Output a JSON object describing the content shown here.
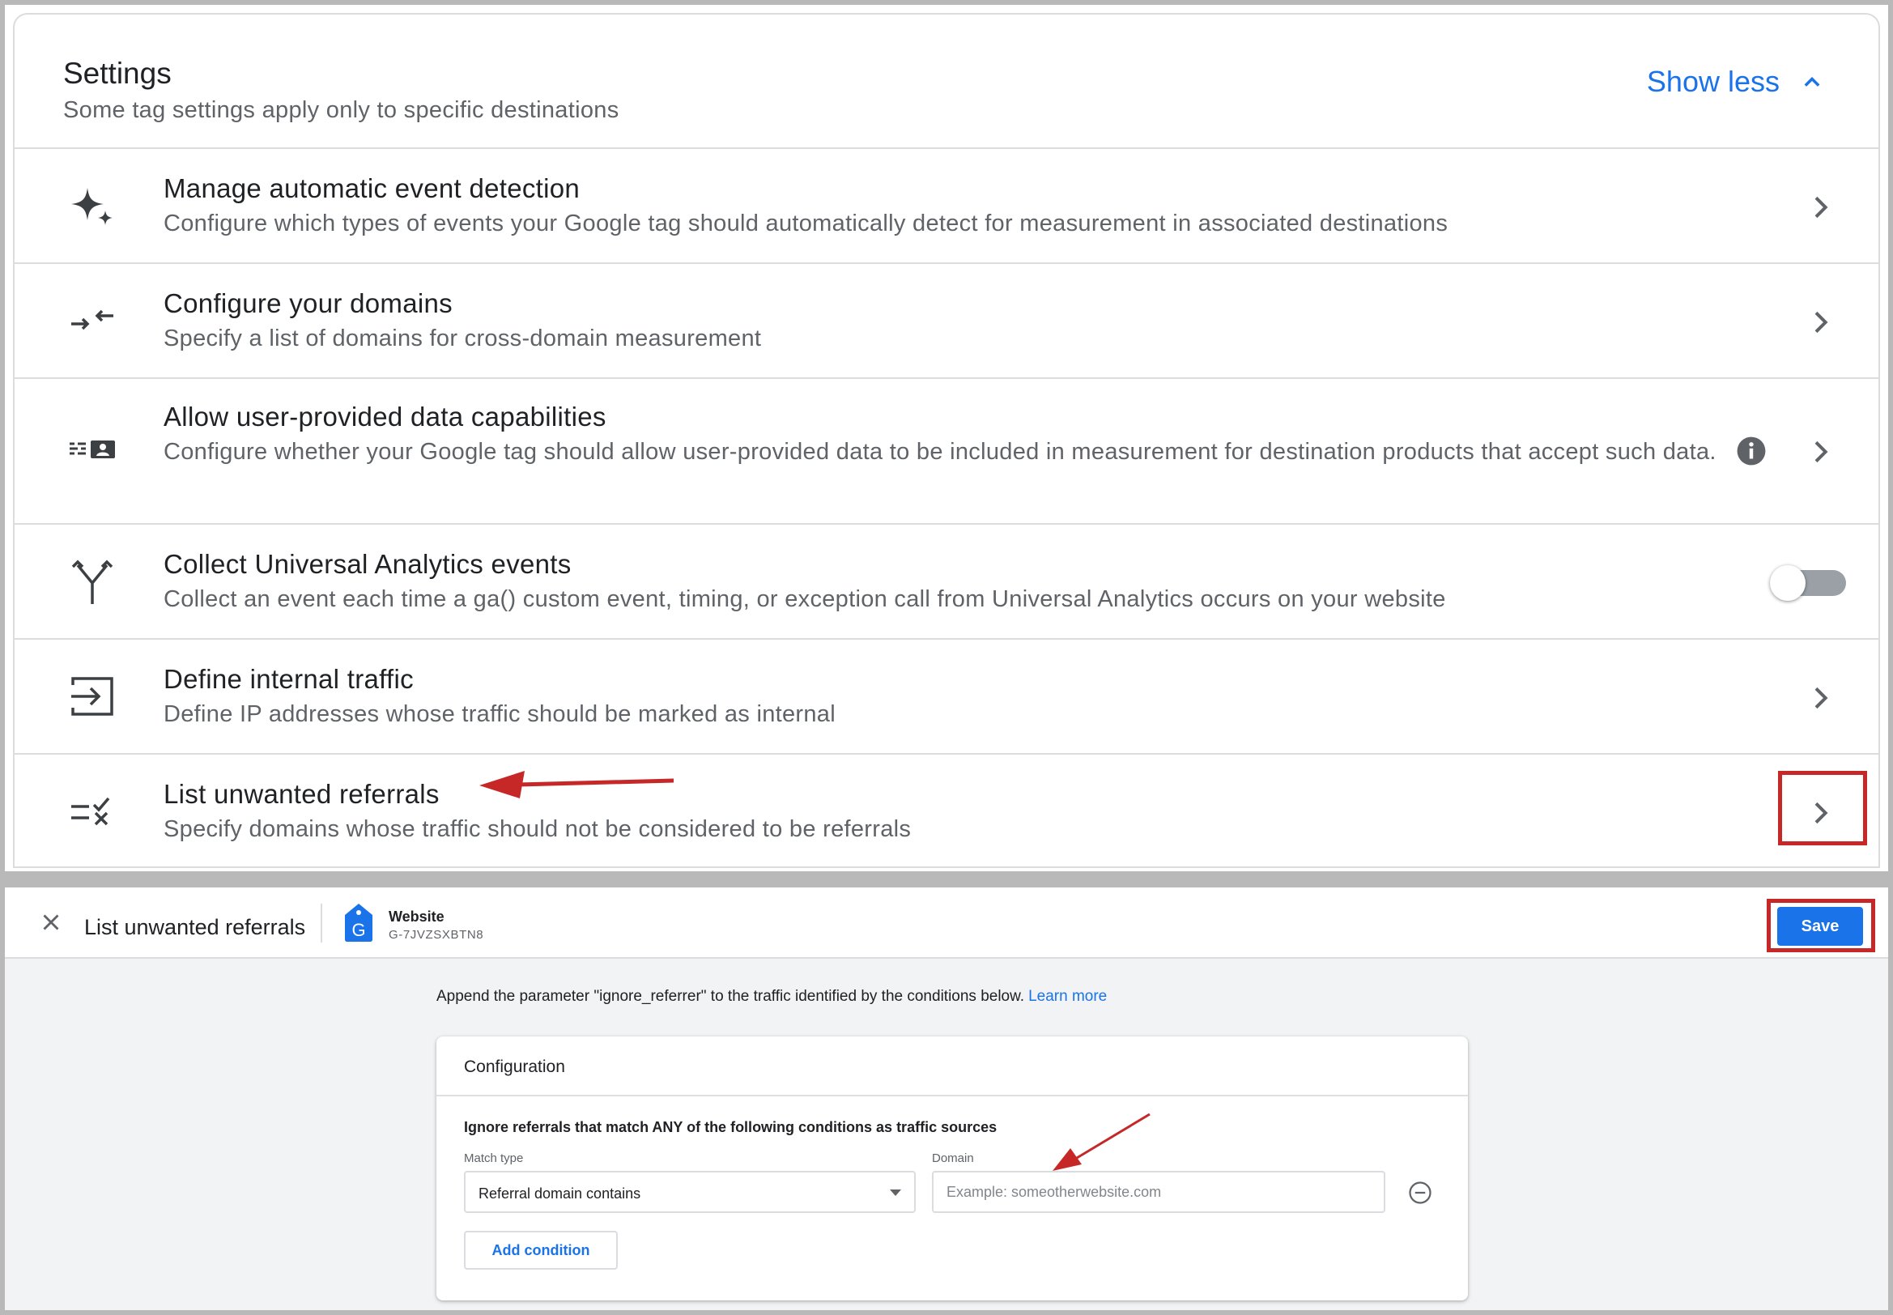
{
  "settings": {
    "title": "Settings",
    "subtitle": "Some tag settings apply only to specific destinations",
    "toggle_label": "Show less",
    "rows": [
      {
        "title": "Manage automatic event detection",
        "desc": "Configure which types of events your Google tag should automatically detect for measurement in associated destinations",
        "icon": "sparkle-icon",
        "control": "chevron"
      },
      {
        "title": "Configure your domains",
        "desc": "Specify a list of domains for cross-domain measurement",
        "icon": "arrows-merge-icon",
        "control": "chevron"
      },
      {
        "title": "Allow user-provided data capabilities",
        "desc": "Configure whether your Google tag should allow user-provided data to be included in measurement for destination products that accept such data.",
        "icon": "contact-card-icon",
        "control": "info+chevron"
      },
      {
        "title": "Collect Universal Analytics events",
        "desc": "Collect an event each time a ga() custom event, timing, or exception call from Universal Analytics occurs on your website",
        "icon": "merge-fork-icon",
        "control": "toggle",
        "toggle_on": false
      },
      {
        "title": "Define internal traffic",
        "desc": "Define IP addresses whose traffic should be marked as internal",
        "icon": "input-arrow-icon",
        "control": "chevron"
      },
      {
        "title": "List unwanted referrals",
        "desc": "Specify domains whose traffic should not be considered to be referrals",
        "icon": "list-check-x-icon",
        "control": "chevron"
      }
    ]
  },
  "editor": {
    "title": "List unwanted referrals",
    "tag_name": "Website",
    "tag_id": "G-7JVZSXBTN8",
    "tag_letter": "G",
    "save_label": "Save",
    "intro": "Append the parameter \"ignore_referrer\" to the traffic identified by the conditions below.",
    "learn_more": "Learn more",
    "config_title": "Configuration",
    "condition_heading": "Ignore referrals that match ANY of the following conditions as traffic sources",
    "match_type_label": "Match type",
    "match_type_value": "Referral domain contains",
    "domain_label": "Domain",
    "domain_placeholder": "Example: someotherwebsite.com",
    "domain_value": "",
    "add_condition_label": "Add condition"
  },
  "colors": {
    "accent": "#1a73e8",
    "annotation": "#c62828",
    "text_primary": "#202124",
    "text_secondary": "#5f6368"
  }
}
